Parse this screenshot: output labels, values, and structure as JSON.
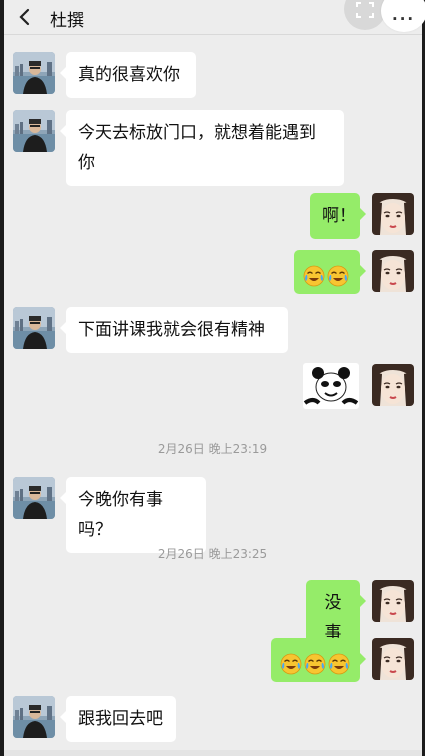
{
  "header": {
    "title": "杜撰"
  },
  "messages": [
    {
      "side": "left",
      "text": "真的很喜欢你"
    },
    {
      "side": "left",
      "text": "今天去标放门口，就想着能遇到你"
    },
    {
      "side": "right",
      "text": "啊！"
    },
    {
      "side": "right",
      "emoji": "laugh-cry-emoji",
      "count": 2
    },
    {
      "side": "left",
      "text": "下面讲课我就会很有精神"
    },
    {
      "side": "right",
      "sticker": "panda-meme-sticker"
    },
    {
      "timestamp": "2月26日 晚上23:19"
    },
    {
      "side": "left",
      "text": "今晚你有事吗？"
    },
    {
      "timestamp": "2月26日 晚上23:25"
    },
    {
      "side": "right",
      "text": "没事"
    },
    {
      "side": "right",
      "emoji": "laugh-cry-emoji",
      "count": 3
    },
    {
      "side": "left",
      "text": "跟我回去吧"
    }
  ],
  "colors": {
    "bubble_right": "#95ec69",
    "bubble_left": "#ffffff",
    "background": "#ededed"
  }
}
